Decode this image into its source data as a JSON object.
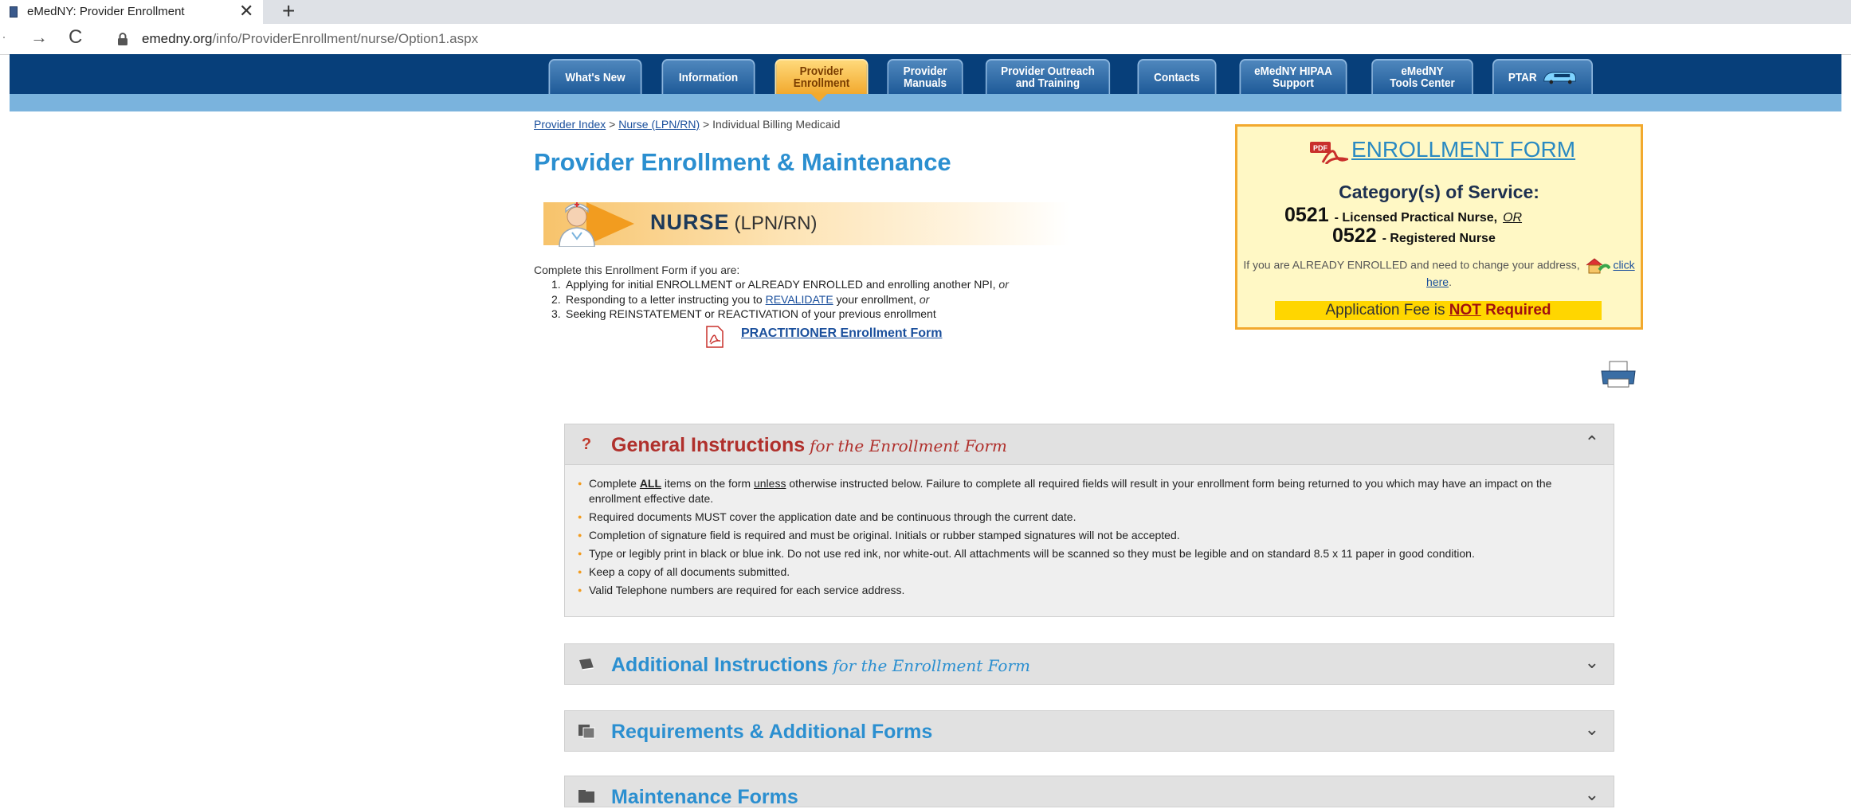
{
  "browser": {
    "tab_title": "eMedNY: Provider Enrollment",
    "tab_close": "✕",
    "new_tab": "+",
    "url_domain": "emedny.org",
    "url_path": "/info/ProviderEnrollment/nurse/Option1.aspx"
  },
  "nav": {
    "whats_new": "What's New",
    "information": "Information",
    "provider_enrollment": "Provider\nEnrollment",
    "provider_manuals": "Provider\nManuals",
    "outreach": "Provider Outreach\nand Training",
    "contacts": "Contacts",
    "hipaa": "eMedNY HIPAA\nSupport",
    "tools": "eMedNY\nTools Center",
    "ptar": "PTAR"
  },
  "breadcrumb": {
    "provider_index": "Provider Index",
    "sep1": " > ",
    "nurse": "Nurse (LPN/RN)",
    "sep2": " > ",
    "current": "Individual Billing Medicaid"
  },
  "page_title": "Provider Enrollment & Maintenance",
  "nurse_banner": {
    "title": "NURSE",
    "subtitle": "(LPN/RN)"
  },
  "intro": {
    "lead": "Complete this Enrollment Form if you are:",
    "items": [
      {
        "num": "1.",
        "text_a": "Applying for initial ENROLLMENT or ALREADY ENROLLED and enrolling another NPI,",
        "or": "or"
      },
      {
        "num": "2.",
        "text_a": "Responding to a letter instructing you to",
        "link": "REVALIDATE",
        "text_b": "your enrollment,",
        "or": "or"
      },
      {
        "num": "3.",
        "text_a": "Seeking REINSTATEMENT or REACTIVATION of your previous enrollment"
      }
    ],
    "practitioner_link": "PRACTITIONER Enrollment Form"
  },
  "enroll_box": {
    "link": "ENROLLMENT FORM",
    "category_title": "Category(s) of Service:",
    "code1": "0521",
    "code1_label": "- Licensed Practical Nurse,",
    "code1_or": "OR",
    "code2": "0522",
    "code2_label": "- Registered Nurse",
    "already_enrolled": "If you are ALREADY ENROLLED and need to change your address,",
    "click_here": "click here",
    "fee_prefix": "Application Fee is",
    "fee_not": "NOT",
    "fee_suffix": "Required"
  },
  "accordion": {
    "general": {
      "icon": "?",
      "title": "General Instructions",
      "subtitle": "for the Enrollment Form",
      "chevron": "⌃",
      "items": [
        {
          "a": "Complete",
          "all": "ALL",
          "b": "items on the form",
          "unless": "unless",
          "c": "otherwise instructed below. Failure to complete all required fields will result in your enrollment form being returned to you which may have an impact on the enrollment effective date."
        },
        {
          "a": "Required documents MUST cover the application date and be continuous through the current date."
        },
        {
          "a": "Completion of signature field is required and must be original. Initials or rubber stamped signatures will not be accepted."
        },
        {
          "a": "Type or legibly print in black or blue ink. Do not use red ink, nor white-out. All attachments will be scanned so they must be legible and on standard 8.5 x 11 paper in good condition."
        },
        {
          "a": "Keep a copy of all documents submitted."
        },
        {
          "a": "Valid Telephone numbers are required for each service address."
        }
      ]
    },
    "additional": {
      "title": "Additional Instructions",
      "subtitle": "for the Enrollment Form",
      "chevron": "⌄"
    },
    "requirements": {
      "title": "Requirements & Additional Forms",
      "chevron": "⌄"
    },
    "maintenance": {
      "title": "Maintenance Forms",
      "chevron": "⌄"
    }
  }
}
